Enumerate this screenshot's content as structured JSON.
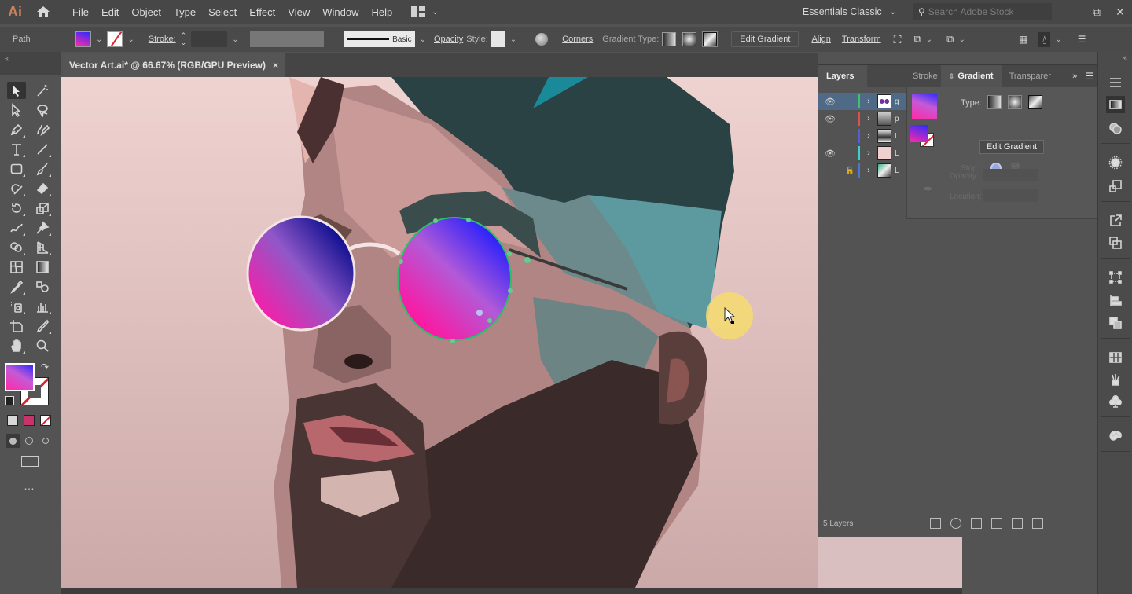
{
  "app": {
    "logo": "Ai",
    "menu": [
      "File",
      "Edit",
      "Object",
      "Type",
      "Select",
      "Effect",
      "View",
      "Window",
      "Help"
    ],
    "workspace": "Essentials Classic",
    "stock_search_placeholder": "Search Adobe Stock"
  },
  "control_bar": {
    "selection_type": "Path",
    "stroke_label": "Stroke:",
    "stroke_style": "Basic",
    "opacity_label": "Opacity",
    "style_label": "Style:",
    "corners_label": "Corners",
    "gradient_type_label": "Gradient Type:",
    "edit_gradient": "Edit Gradient",
    "align": "Align",
    "transform": "Transform"
  },
  "document": {
    "tab_title": "Vector Art.ai* @ 66.67% (RGB/GPU Preview)",
    "close": "×"
  },
  "tools": [
    "selection-tool",
    "magic-wand-tool",
    "direct-selection-tool",
    "lasso-tool",
    "pen-tool",
    "curvature-tool",
    "type-tool",
    "line-segment-tool",
    "rectangle-tool",
    "paintbrush-tool",
    "shaper-tool",
    "eraser-tool",
    "rotate-tool",
    "scale-tool",
    "warp-tool",
    "puppet-warp-tool",
    "shape-builder-tool",
    "perspective-grid-tool",
    "mesh-tool",
    "gradient-tool",
    "eyedropper-tool",
    "blend-tool",
    "symbol-sprayer-tool",
    "column-graph-tool",
    "artboard-tool",
    "slice-tool",
    "hand-tool",
    "zoom-tool"
  ],
  "colors": {
    "fill_gradient_start": "#ff2aa8",
    "fill_gradient_end": "#2b2bff",
    "stroke": "none",
    "accent_selection": "#4f6a86",
    "canvas_bg": "#efd3d1"
  },
  "panels": {
    "tabs": [
      "Layers",
      "Stroke",
      "Gradient",
      "Transparer"
    ],
    "layers": [
      {
        "name": "g",
        "visible": true,
        "locked": false,
        "color": "#3cc46a",
        "selected": true
      },
      {
        "name": "p",
        "visible": true,
        "locked": false,
        "color": "#e0504a",
        "selected": false
      },
      {
        "name": "L",
        "visible": false,
        "locked": false,
        "color": "#5a5adc",
        "selected": false
      },
      {
        "name": "L",
        "visible": true,
        "locked": false,
        "color": "#3ad0d0",
        "selected": false
      },
      {
        "name": "L",
        "visible": false,
        "locked": true,
        "color": "#4a78d0",
        "selected": false
      }
    ],
    "layers_count": "5 Layers",
    "gradient": {
      "type_label": "Type:",
      "edit_gradient": "Edit Gradient",
      "stop_label": "Stop:",
      "opacity_label": "Opacity:",
      "location_label": "Location:"
    }
  }
}
